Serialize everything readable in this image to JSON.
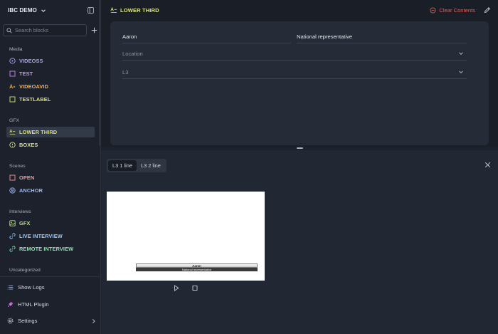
{
  "app": {
    "title": "IBC DEMO"
  },
  "search": {
    "placeholder": "Search blocks"
  },
  "sidebar": {
    "groups": [
      {
        "label": "Media",
        "items": [
          {
            "label": "VIDEOSS",
            "icon": "play-circle-icon",
            "color": "#a6a6f2"
          },
          {
            "label": "TEST",
            "icon": "square-icon",
            "color": "#c58ef0"
          },
          {
            "label": "VIDEOAVID",
            "icon": "text-size-icon",
            "color": "#f0b05a"
          },
          {
            "label": "TESTLABEL",
            "icon": "square-icon",
            "color": "#d9e07a"
          }
        ]
      },
      {
        "label": "GFX",
        "items": [
          {
            "label": "LOWER THIRD",
            "icon": "lower-third-icon",
            "color": "#d9e07a",
            "active": true
          },
          {
            "label": "BOXES",
            "icon": "info-circle-icon",
            "color": "#d9e07a"
          }
        ]
      },
      {
        "label": "Scenes",
        "items": [
          {
            "label": "OPEN",
            "icon": "square-icon",
            "color": "#ee9a9a"
          },
          {
            "label": "ANCHOR",
            "icon": "user-circle-icon",
            "color": "#9ab8f2"
          }
        ]
      },
      {
        "label": "Interviews",
        "items": [
          {
            "label": "GFX",
            "icon": "image-icon",
            "color": "#b6e07a"
          },
          {
            "label": "LIVE INTERVIEW",
            "icon": "link-icon",
            "color": "#9ec8f5"
          },
          {
            "label": "REMOTE INTERVIEW",
            "icon": "link-icon",
            "color": "#8ee0b0"
          }
        ]
      },
      {
        "label": "Uncategorized",
        "items": []
      }
    ],
    "footer": [
      {
        "label": "Show Logs",
        "icon": "list-icon"
      },
      {
        "label": "HTML Plugin",
        "icon": "plugin-icon"
      },
      {
        "label": "Settings",
        "icon": "gear-icon"
      }
    ]
  },
  "panel": {
    "title": "LOWER THIRD",
    "clear_label": "Clear Contents",
    "fields": {
      "name": "Aaron",
      "role": "National representative",
      "location_placeholder": "Location",
      "template_value": "L3"
    }
  },
  "preview": {
    "tabs": [
      "L3 1 line",
      "L3 2 line"
    ],
    "active_tab": "L3 1 line",
    "name": "Aaron",
    "role": "National representative"
  },
  "colors": {
    "accent_yellow": "#d9e07a",
    "danger": "#e25b5b",
    "background": "#1c212b"
  }
}
